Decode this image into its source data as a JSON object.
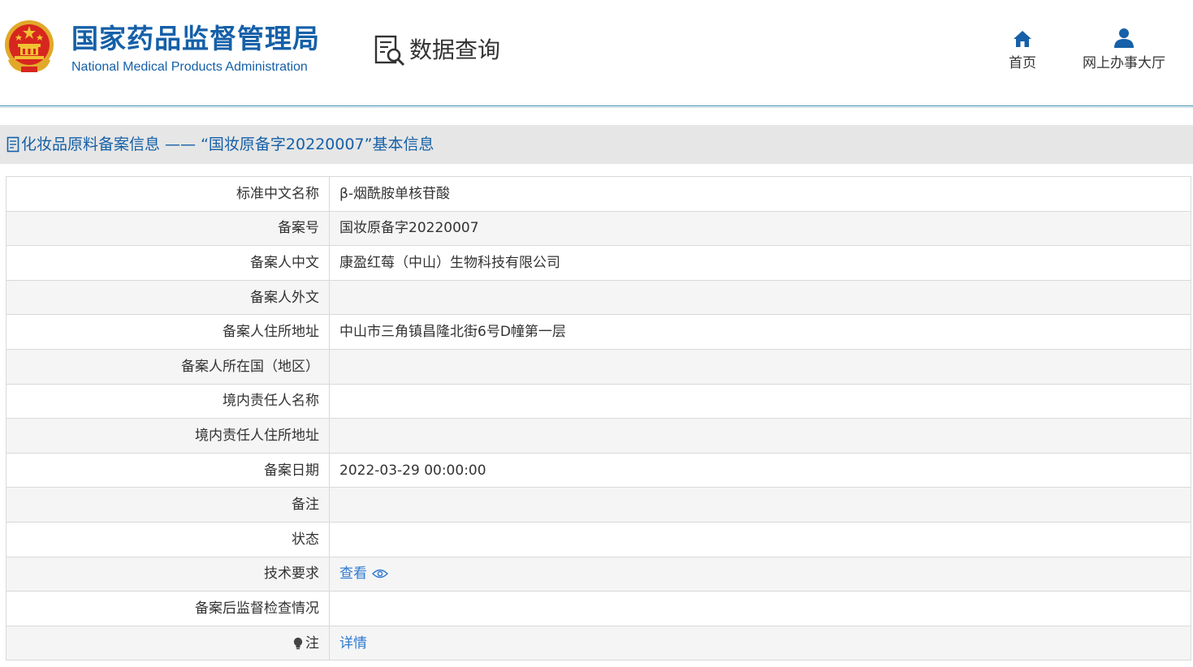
{
  "header": {
    "org_name_cn": "国家药品监督管理局",
    "org_name_en": "National Medical Products Administration",
    "data_query": "数据查询",
    "nav": [
      {
        "label": "首页",
        "icon": "home-icon"
      },
      {
        "label": "网上办事大厅",
        "icon": "user-icon"
      }
    ]
  },
  "colors": {
    "brand_blue": "#1560a8",
    "link_blue": "#2f7ad0",
    "title_bar_bg": "#e6e6e6",
    "row_alt_bg": "#f5f5f5",
    "emblem_red": "#d7261f",
    "emblem_gold": "#f1c232"
  },
  "page": {
    "title": "化妆品原料备案信息 —— “国妆原备字20220007”基本信息"
  },
  "info": {
    "rows": [
      {
        "label": "标准中文名称",
        "value": "β-烟酰胺单核苷酸"
      },
      {
        "label": "备案号",
        "value": "国妆原备字20220007"
      },
      {
        "label": "备案人中文",
        "value": "康盈红莓（中山）生物科技有限公司"
      },
      {
        "label": "备案人外文",
        "value": ""
      },
      {
        "label": "备案人住所地址",
        "value": "中山市三角镇昌隆北街6号D幢第一层"
      },
      {
        "label": "备案人所在国（地区）",
        "value": ""
      },
      {
        "label": "境内责任人名称",
        "value": ""
      },
      {
        "label": "境内责任人住所地址",
        "value": ""
      },
      {
        "label": "备案日期",
        "value": "2022-03-29 00:00:00"
      },
      {
        "label": "备注",
        "value": ""
      },
      {
        "label": "状态",
        "value": ""
      },
      {
        "label": "技术要求",
        "value": "查看"
      },
      {
        "label": "备案后监督检查情况",
        "value": ""
      },
      {
        "label": "注",
        "value": "详情"
      }
    ]
  }
}
